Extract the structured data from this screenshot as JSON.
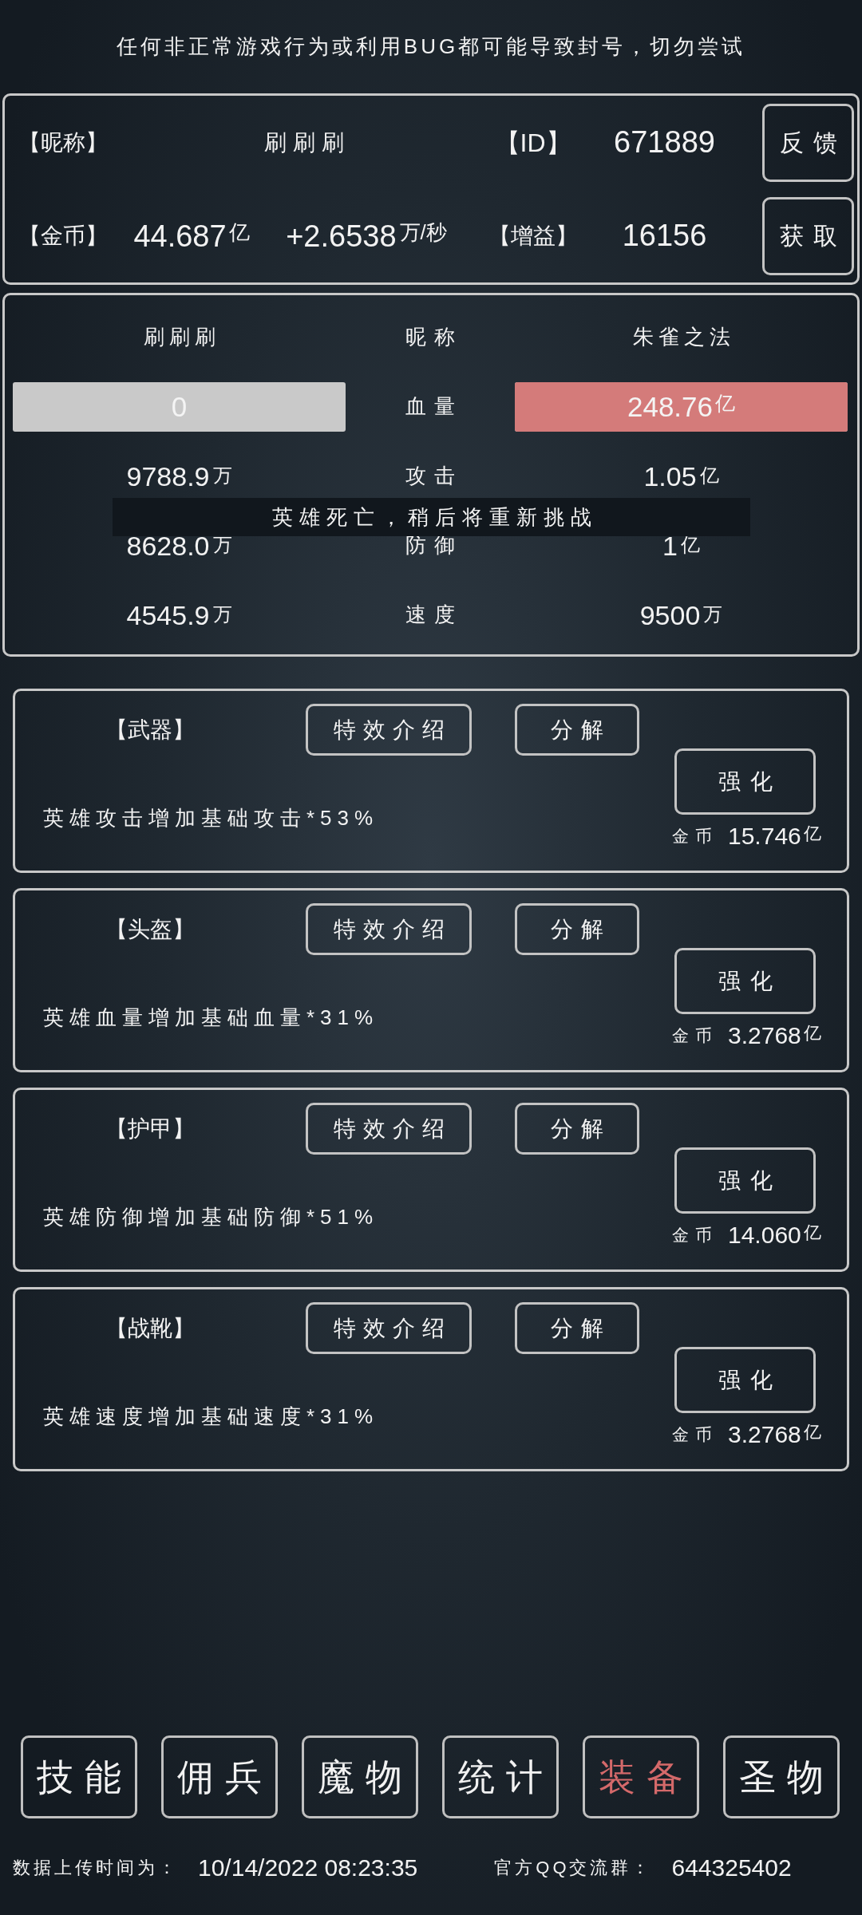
{
  "warning": "任何非正常游戏行为或利用BUG都可能导致封号，切勿尝试",
  "profile": {
    "nickname_label": "【昵称】",
    "nickname": "刷刷刷",
    "id_label": "【ID】",
    "id": "671889",
    "feedback_button": "反馈",
    "gold_label": "【金币】",
    "gold": {
      "value": "44.687",
      "unit": "亿"
    },
    "rate": {
      "value": "+2.6538",
      "unit": "万/秒"
    },
    "bonus_label": "【增益】",
    "bonus": "16156",
    "get_button": "获取"
  },
  "battle": {
    "player_name": "刷刷刷",
    "name_label": "昵称",
    "enemy_name": "朱雀之法",
    "hp": {
      "label": "血量",
      "left": {
        "value": "0",
        "level": 0
      },
      "right": {
        "value": "248.76",
        "unit": "亿",
        "level": 1
      }
    },
    "stats": [
      {
        "left": {
          "value": "9788.9",
          "unit": "万"
        },
        "label": "攻击",
        "right": {
          "value": "1.05",
          "unit": "亿"
        }
      },
      {
        "left": {
          "value": "8628.0",
          "unit": "万"
        },
        "label": "防御",
        "right": {
          "value": "1",
          "unit": "亿"
        }
      },
      {
        "left": {
          "value": "4545.9",
          "unit": "万"
        },
        "label": "速度",
        "right": {
          "value": "9500",
          "unit": "万"
        }
      }
    ],
    "toast": "英雄死亡，稍后将重新挑战"
  },
  "equipment": [
    {
      "slot": "【武器】",
      "effect_button": "特效介绍",
      "dismantle_button": "分解",
      "description": "英雄攻击增加基础攻击*53%",
      "upgrade_button": "强化",
      "cost_label": "金币",
      "cost": {
        "value": "15.746",
        "unit": "亿"
      }
    },
    {
      "slot": "【头盔】",
      "effect_button": "特效介绍",
      "dismantle_button": "分解",
      "description": "英雄血量增加基础血量*31%",
      "upgrade_button": "强化",
      "cost_label": "金币",
      "cost": {
        "value": "3.2768",
        "unit": "亿"
      }
    },
    {
      "slot": "【护甲】",
      "effect_button": "特效介绍",
      "dismantle_button": "分解",
      "description": "英雄防御增加基础防御*51%",
      "upgrade_button": "强化",
      "cost_label": "金币",
      "cost": {
        "value": "14.060",
        "unit": "亿"
      }
    },
    {
      "slot": "【战靴】",
      "effect_button": "特效介绍",
      "dismantle_button": "分解",
      "description": "英雄速度增加基础速度*31%",
      "upgrade_button": "强化",
      "cost_label": "金币",
      "cost": {
        "value": "3.2768",
        "unit": "亿"
      }
    }
  ],
  "nav": [
    {
      "label": "技能",
      "selected": false
    },
    {
      "label": "佣兵",
      "selected": false
    },
    {
      "label": "魔物",
      "selected": false
    },
    {
      "label": "统计",
      "selected": false
    },
    {
      "label": "装备",
      "selected": true
    },
    {
      "label": "圣物",
      "selected": false
    }
  ],
  "footer": {
    "upload_label": "数据上传时间为：",
    "upload_time": "10/14/2022 08:23:35",
    "group_label": "官方QQ交流群：",
    "group_number": "644325402"
  }
}
